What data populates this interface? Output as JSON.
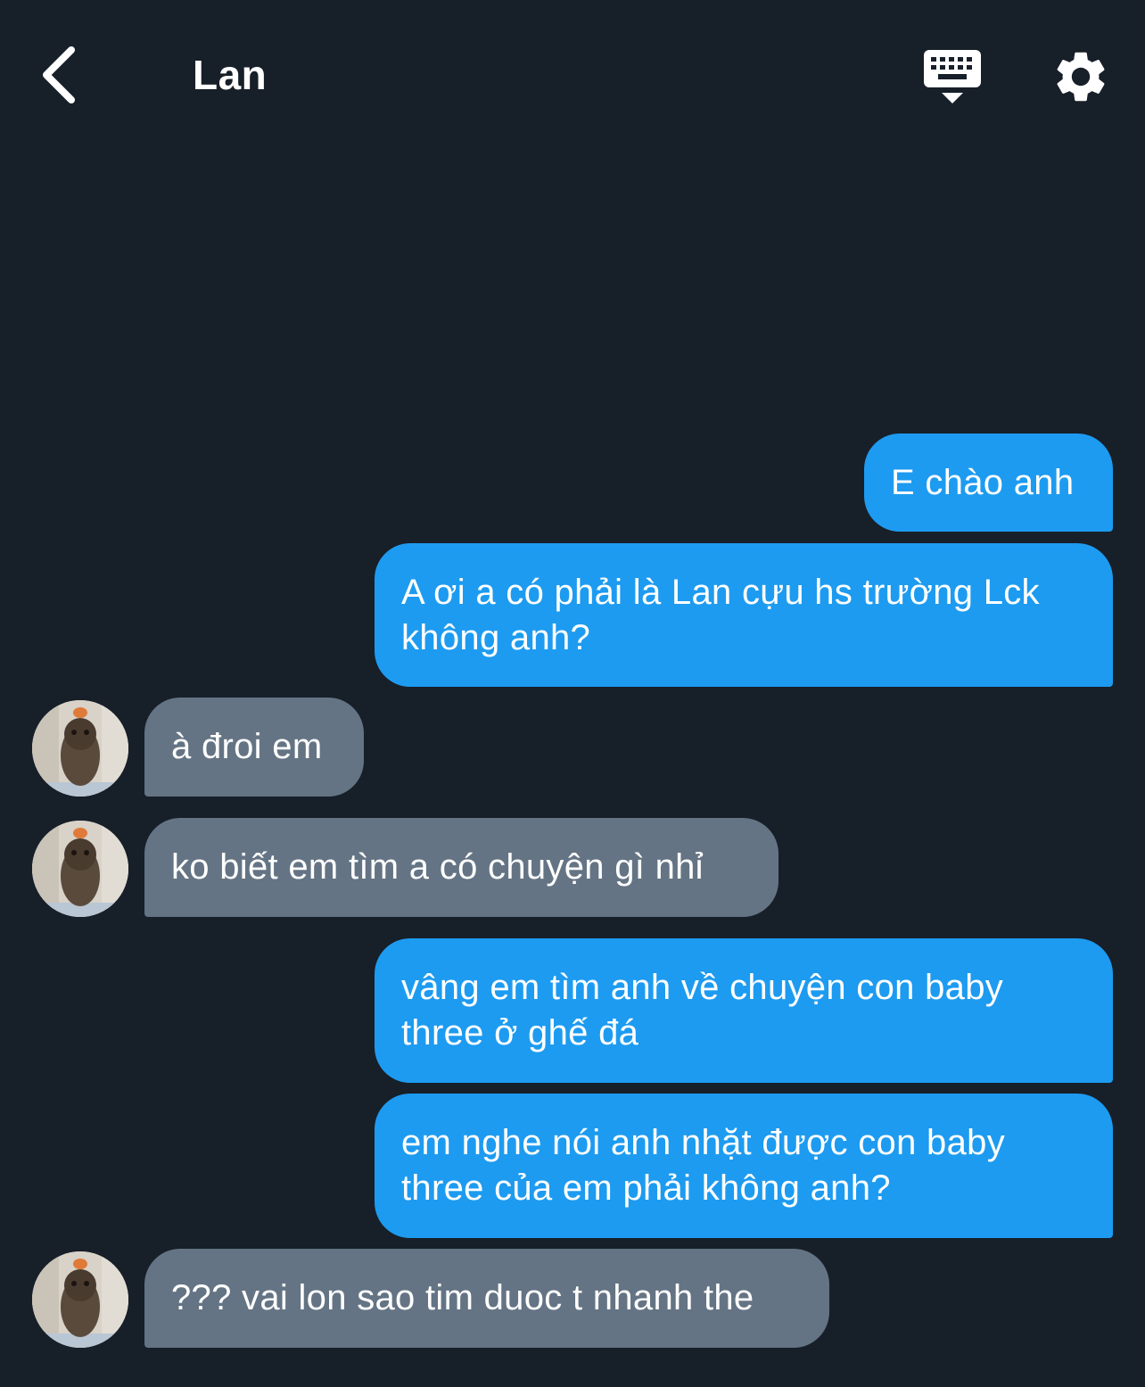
{
  "header": {
    "title": "Lan",
    "back_icon": "chevron-left-icon",
    "keyboard_icon": "keyboard-hide-icon",
    "settings_icon": "gear-icon"
  },
  "colors": {
    "background": "#171f29",
    "sent_bubble": "#1d9bf0",
    "received_bubble": "#647484",
    "text": "#ffffff"
  },
  "messages": [
    {
      "direction": "sent",
      "text": "E chào anh"
    },
    {
      "direction": "sent",
      "text": "A ơi a có phải là Lan cựu hs trường Lck\nkhông anh?"
    },
    {
      "direction": "received",
      "text": "à đroi em"
    },
    {
      "direction": "received",
      "text": "ko biết em tìm a có chuyện gì nhỉ"
    },
    {
      "direction": "sent",
      "text": "vâng em tìm anh về chuyện con baby\nthree ở ghế đá"
    },
    {
      "direction": "sent",
      "text": "em nghe nói anh nhặt được con baby\nthree của em phải không anh?"
    },
    {
      "direction": "received",
      "text": "??? vai lon sao tim duoc t nhanh the"
    }
  ]
}
